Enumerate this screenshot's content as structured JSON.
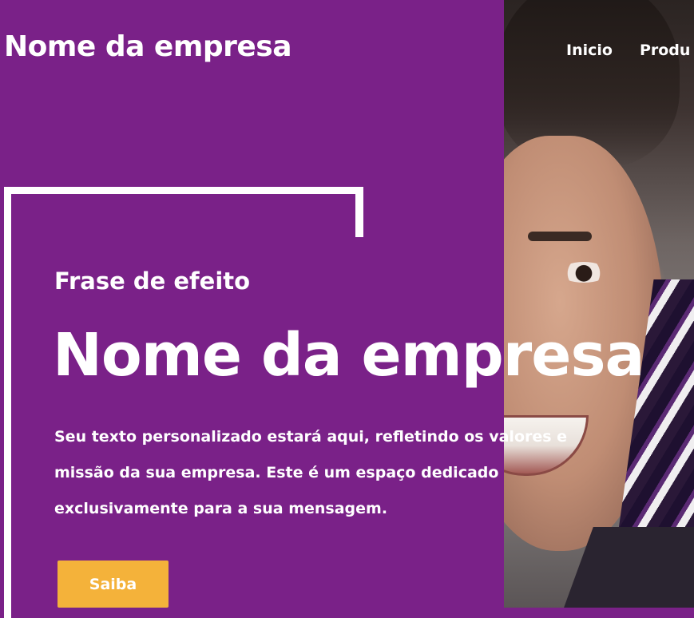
{
  "header": {
    "brand": "Nome da empresa",
    "nav": [
      "Inicio",
      "Produ"
    ]
  },
  "hero": {
    "tagline": "Frase de efeito",
    "title": "Nome da empresa",
    "body_lines": [
      "Seu texto personalizado estará aqui, refletindo os valores e",
      "missão da sua empresa. Este é um espaço dedicado",
      "exclusivamente para a sua mensagem."
    ],
    "cta_label": "Saiba"
  },
  "colors": {
    "primary": "#7a2188",
    "accent": "#f4b23a",
    "text": "#ffffff"
  }
}
